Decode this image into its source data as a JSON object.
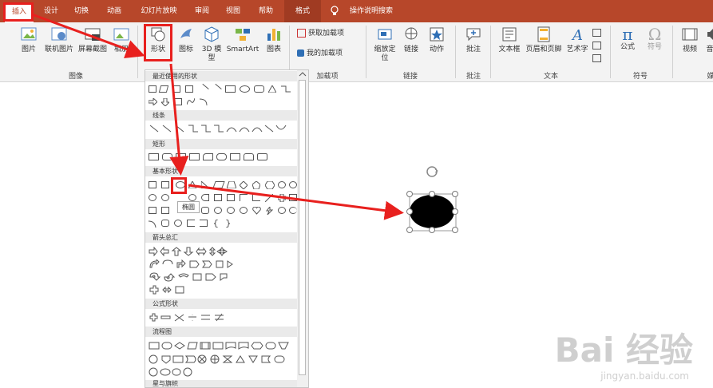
{
  "tabs": [
    {
      "label": "插入",
      "active": true
    },
    {
      "label": "设计"
    },
    {
      "label": "切换"
    },
    {
      "label": "动画"
    },
    {
      "label": "幻灯片放映"
    },
    {
      "label": "审阅"
    },
    {
      "label": "视图"
    },
    {
      "label": "帮助"
    },
    {
      "label": "格式"
    },
    {
      "label": "操作说明搜索"
    }
  ],
  "ribbon": {
    "images": {
      "picture": "图片",
      "online_picture": "联机图片",
      "screenshot": "屏幕截图",
      "album": "相册",
      "group": "图像"
    },
    "illustrations": {
      "shapes": "形状",
      "icons": "图标",
      "model3d": "3D 模型",
      "smartart": "SmartArt",
      "chart": "图表"
    },
    "addins": {
      "get": "获取加载项",
      "my": "我的加载项",
      "group": "加载项"
    },
    "links": {
      "zoom": "缩放定位",
      "link": "链接",
      "action": "动作",
      "group": "链接"
    },
    "comments": {
      "comment": "批注",
      "group": "批注"
    },
    "text": {
      "textbox": "文本框",
      "header_footer": "页眉和页脚",
      "wordart": "艺术字",
      "group": "文本"
    },
    "symbols": {
      "equation": "公式",
      "symbol": "符号",
      "group": "符号"
    },
    "media": {
      "video": "视频",
      "audio": "音",
      "group": "媒"
    }
  },
  "gallery": {
    "categories": [
      "最近使用的形状",
      "线条",
      "矩形",
      "基本形状",
      "箭头总汇",
      "公式形状",
      "流程图",
      "星与旗帜"
    ],
    "tooltip": "椭圆"
  },
  "colors": {
    "accent": "#b7472a",
    "highlight": "#e8201e"
  },
  "watermark": {
    "brand": "Bai 经验",
    "url": "jingyan.baidu.com"
  }
}
